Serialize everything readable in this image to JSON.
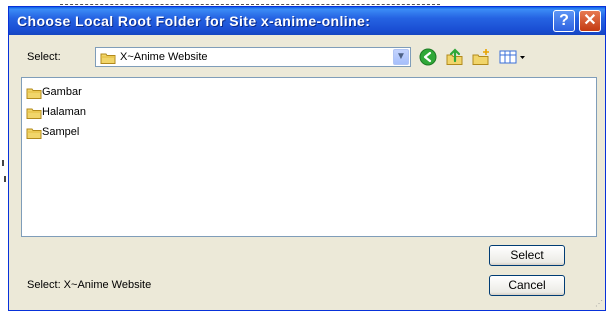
{
  "dialog": {
    "title": "Choose Local Root Folder for Site x-anime-online:",
    "help_glyph": "?",
    "close_glyph": "✕"
  },
  "toolbar": {
    "select_label": "Select:",
    "current_folder": "X~Anime Website",
    "icons": [
      "folder-icon",
      "back-icon",
      "up-folder-icon",
      "new-folder-icon",
      "views-menu-icon"
    ]
  },
  "file_list": {
    "items": [
      {
        "name": "Gambar",
        "icon": "folder-icon"
      },
      {
        "name": "Halaman",
        "icon": "folder-icon"
      },
      {
        "name": "Sampel",
        "icon": "folder-icon"
      }
    ]
  },
  "footer": {
    "selection_text": "Select: X~Anime Website",
    "select_button": "Select",
    "cancel_button": "Cancel"
  },
  "colors": {
    "titlebar": "#1f58dc",
    "dialog_bg": "#ece9d8",
    "folder": "#f1d56a"
  }
}
